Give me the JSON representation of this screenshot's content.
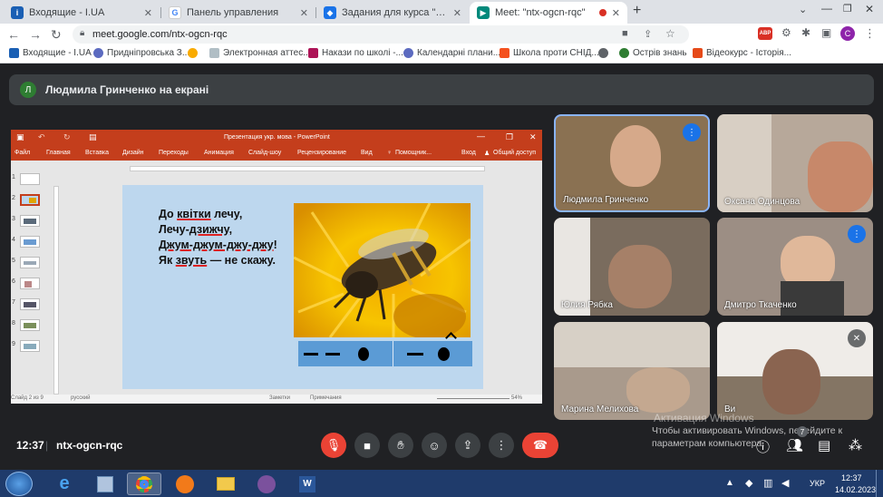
{
  "tabs": [
    {
      "title": "Входящие - I.UA",
      "fav_color": "#1a5fb4",
      "fav_glyph": "i"
    },
    {
      "title": "Панель управления",
      "fav_color": "#4285f4",
      "fav_glyph": "G"
    },
    {
      "title": "Задания для курса \"Культура до",
      "fav_color": "#1a73e8",
      "fav_glyph": "👤"
    },
    {
      "title": "Meet: \"ntx-ogcn-rqc\"",
      "fav_color": "#00897b",
      "fav_glyph": "▶"
    }
  ],
  "address": {
    "url": "meet.google.com/ntx-ogcn-rqc"
  },
  "profile_initial": "C",
  "bookmarks": [
    {
      "label": "Входящие - I.UA",
      "color": "#1a5fb4"
    },
    {
      "label": "Придніпровська З...",
      "color": "#5c6bc0"
    },
    {
      "label": "",
      "color": "#f9ab00"
    },
    {
      "label": "Электронная аттес...",
      "color": "#90a4ae"
    },
    {
      "label": "Накази по школі -...",
      "color": "#ad1457"
    },
    {
      "label": "Календарні плани...",
      "color": "#5c6bc0"
    },
    {
      "label": "Школа проти СНІД...",
      "color": "#f4511e"
    },
    {
      "label": "",
      "color": "#5f6368"
    },
    {
      "label": "Острів знань",
      "color": "#2e7d32"
    },
    {
      "label": "Відеокурс - Історія...",
      "color": "#e64a19"
    }
  ],
  "presenter": {
    "avatar_initial": "Л",
    "text": "Людмила Гринченко на екрані"
  },
  "powerpoint": {
    "title": "Презентация укр. мова - PowerPoint",
    "menu": [
      "Файл",
      "Главная",
      "Вставка",
      "Дизайн",
      "Переходы",
      "Анимация",
      "Слайд-шоу",
      "Рецензирование",
      "Вид",
      "Помощник...",
      "Вход",
      "Общий доступ"
    ],
    "thumb_numbers": [
      "1",
      "2",
      "3",
      "4",
      "5",
      "6",
      "7",
      "8",
      "9"
    ],
    "poem": [
      "До квітки лечу,",
      "Лечу-дзижчу,",
      "Джум-джум-джу-джу!",
      "Як звуть — не скажу."
    ],
    "status_left": "Слайд 2 из 9",
    "status_lang": "русский",
    "status_notes": "Заметки",
    "status_comments": "Примечания",
    "zoom": "54%"
  },
  "participants": [
    {
      "name": "Людмила Гринченко",
      "bg": "#8a7152",
      "speaking": true,
      "muted": false
    },
    {
      "name": "Оксана Одинцова",
      "bg": "#b7a89a",
      "speaking": false,
      "muted": false
    },
    {
      "name": "Юлия Рябка",
      "bg": "#7a6c5e",
      "speaking": false,
      "muted": false
    },
    {
      "name": "Дмитро Ткаченко",
      "bg": "#9c8e84",
      "speaking": true,
      "muted": false
    },
    {
      "name": "Марина Мелихова",
      "bg": "#a99a8c",
      "speaking": false,
      "muted": false
    },
    {
      "name": "Ви",
      "bg": "#847564",
      "speaking": false,
      "muted": true
    }
  ],
  "meeting": {
    "time": "12:37",
    "code": "ntx-ogcn-rqc",
    "participant_count": "7"
  },
  "activation": {
    "line1": "Активация Windows",
    "line2": "Чтобы активировать Windows, перейдите к",
    "line3": "параметрам компьютера."
  },
  "taskbar": {
    "lang": "УКР",
    "time": "12:37",
    "date": "14.02.2023"
  }
}
